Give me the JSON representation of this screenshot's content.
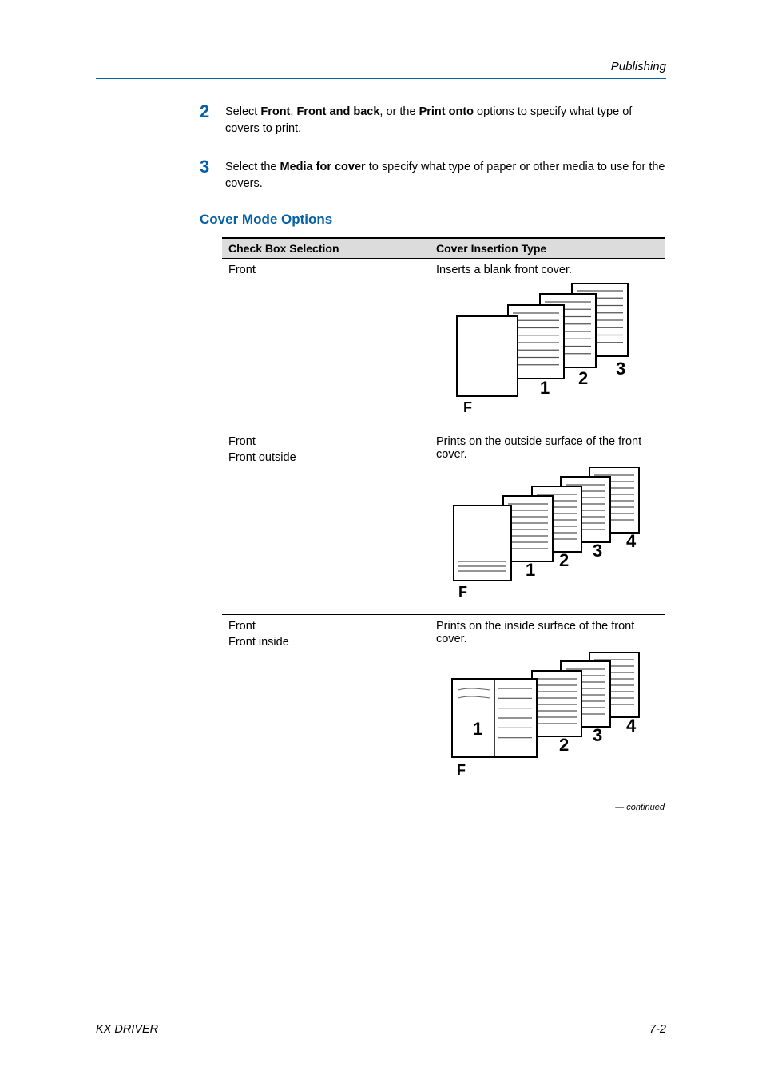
{
  "header": {
    "running_head": "Publishing"
  },
  "steps": [
    {
      "num": "2",
      "html": "Select <b>Front</b>, <b>Front and back</b>, or the <b>Print onto</b> options to specify what type of covers to print."
    },
    {
      "num": "3",
      "html": "Select the <b>Media for cover</b> to specify what type of paper or other media to use for the covers."
    }
  ],
  "section_heading": "Cover Mode Options",
  "table": {
    "headers": [
      "Check Box Selection",
      "Cover Insertion Type"
    ],
    "rows": [
      {
        "left_lines": [
          "Front"
        ],
        "right_text": "Inserts a blank front cover.",
        "diagram": "blank-front"
      },
      {
        "left_lines": [
          "Front",
          "Front outside"
        ],
        "right_text": "Prints on the outside surface of the front cover.",
        "diagram": "front-outside"
      },
      {
        "left_lines": [
          "Front",
          "Front inside"
        ],
        "right_text": "Prints on the inside surface of the front cover.",
        "diagram": "front-inside"
      }
    ]
  },
  "continued_label": "— continued",
  "footer": {
    "left": "KX DRIVER",
    "right": "7-2"
  }
}
